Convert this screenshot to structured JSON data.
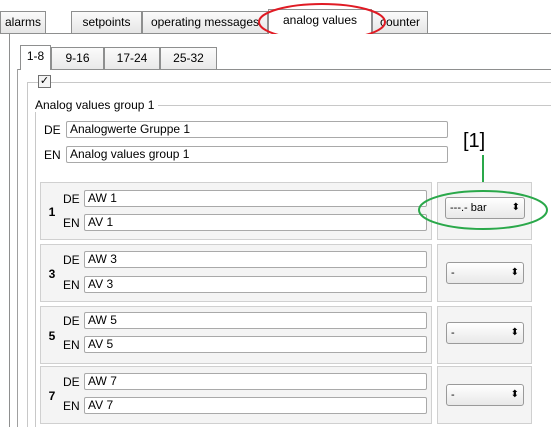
{
  "tabs": [
    {
      "label": "alarms"
    },
    {
      "label": "setpoints"
    },
    {
      "label": "operating messages"
    },
    {
      "label": "analog values"
    },
    {
      "label": "counter"
    }
  ],
  "subtabs": [
    {
      "label": "1-8"
    },
    {
      "label": "9-16"
    },
    {
      "label": "17-24"
    },
    {
      "label": "25-32"
    }
  ],
  "checkbox": {
    "mark": "✓"
  },
  "group": {
    "title": "Analog values group 1",
    "de_label": "DE",
    "de_value": "Analogwerte Gruppe 1",
    "en_label": "EN",
    "en_value": "Analog values group 1"
  },
  "footnote": "[1]",
  "rows": [
    {
      "num": "1",
      "de_label": "DE",
      "de": "AW 1",
      "en_label": "EN",
      "en": "AV 1",
      "unit": "---.- bar",
      "arrow": "⬍"
    },
    {
      "num": "3",
      "de_label": "DE",
      "de": "AW 3",
      "en_label": "EN",
      "en": "AV 3",
      "unit": "-",
      "arrow": "⬍"
    },
    {
      "num": "5",
      "de_label": "DE",
      "de": "AW 5",
      "en_label": "EN",
      "en": "AV 5",
      "unit": "-",
      "arrow": "⬍"
    },
    {
      "num": "7",
      "de_label": "DE",
      "de": "AW 7",
      "en_label": "EN",
      "en": "AV 7",
      "unit": "-",
      "arrow": "⬍"
    }
  ],
  "colors": {
    "highlight_red": "#e01b24",
    "highlight_green": "#2aa84a"
  }
}
